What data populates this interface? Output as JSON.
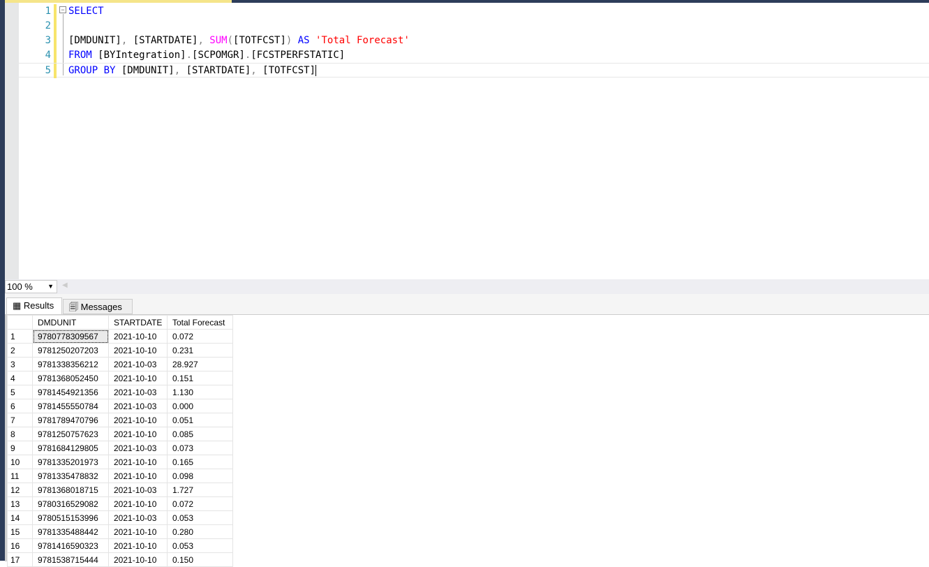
{
  "editor": {
    "lines": [
      {
        "num": "1",
        "parts": [
          {
            "t": "SELECT",
            "c": "kw"
          }
        ]
      },
      {
        "num": "2",
        "parts": []
      },
      {
        "num": "3",
        "parts": [
          {
            "t": "[DMDUNIT]",
            "c": ""
          },
          {
            "t": ", ",
            "c": "gray"
          },
          {
            "t": "[STARTDATE]",
            "c": ""
          },
          {
            "t": ", ",
            "c": "gray"
          },
          {
            "t": "SUM",
            "c": "fn"
          },
          {
            "t": "(",
            "c": "gray"
          },
          {
            "t": "[TOTFCST]",
            "c": ""
          },
          {
            "t": ") ",
            "c": "gray"
          },
          {
            "t": "AS ",
            "c": "kw"
          },
          {
            "t": "'Total Forecast'",
            "c": "str"
          }
        ]
      },
      {
        "num": "4",
        "parts": [
          {
            "t": "FROM ",
            "c": "kw"
          },
          {
            "t": "[BYIntegration]",
            "c": ""
          },
          {
            "t": ".",
            "c": "gray"
          },
          {
            "t": "[SCPOMGR]",
            "c": ""
          },
          {
            "t": ".",
            "c": "gray"
          },
          {
            "t": "[FCSTPERFSTATIC]",
            "c": ""
          }
        ]
      },
      {
        "num": "5",
        "parts": [
          {
            "t": "GROUP BY ",
            "c": "kw"
          },
          {
            "t": "[DMDUNIT]",
            "c": ""
          },
          {
            "t": ", ",
            "c": "gray"
          },
          {
            "t": "[STARTDATE]",
            "c": ""
          },
          {
            "t": ", ",
            "c": "gray"
          },
          {
            "t": "[TOTFCST]",
            "c": ""
          }
        ]
      }
    ]
  },
  "zoom": {
    "value": "100 %"
  },
  "tabs": {
    "results": "Results",
    "messages": "Messages"
  },
  "grid": {
    "columns": [
      "DMDUNIT",
      "STARTDATE",
      "Total Forecast"
    ],
    "rows": [
      [
        "1",
        "9780778309567",
        "2021-10-10",
        "0.072"
      ],
      [
        "2",
        "9781250207203",
        "2021-10-10",
        "0.231"
      ],
      [
        "3",
        "9781338356212",
        "2021-10-03",
        "28.927"
      ],
      [
        "4",
        "9781368052450",
        "2021-10-10",
        "0.151"
      ],
      [
        "5",
        "9781454921356",
        "2021-10-03",
        "1.130"
      ],
      [
        "6",
        "9781455550784",
        "2021-10-03",
        "0.000"
      ],
      [
        "7",
        "9781789470796",
        "2021-10-10",
        "0.051"
      ],
      [
        "8",
        "9781250757623",
        "2021-10-10",
        "0.085"
      ],
      [
        "9",
        "9781684129805",
        "2021-10-03",
        "0.073"
      ],
      [
        "10",
        "9781335201973",
        "2021-10-10",
        "0.165"
      ],
      [
        "11",
        "9781335478832",
        "2021-10-10",
        "0.098"
      ],
      [
        "12",
        "9781368018715",
        "2021-10-03",
        "1.727"
      ],
      [
        "13",
        "9780316529082",
        "2021-10-10",
        "0.072"
      ],
      [
        "14",
        "9780515153996",
        "2021-10-03",
        "0.053"
      ],
      [
        "15",
        "9781335488442",
        "2021-10-10",
        "0.280"
      ],
      [
        "16",
        "9781416590323",
        "2021-10-10",
        "0.053"
      ],
      [
        "17",
        "9781538715444",
        "2021-10-10",
        "0.150"
      ]
    ]
  }
}
